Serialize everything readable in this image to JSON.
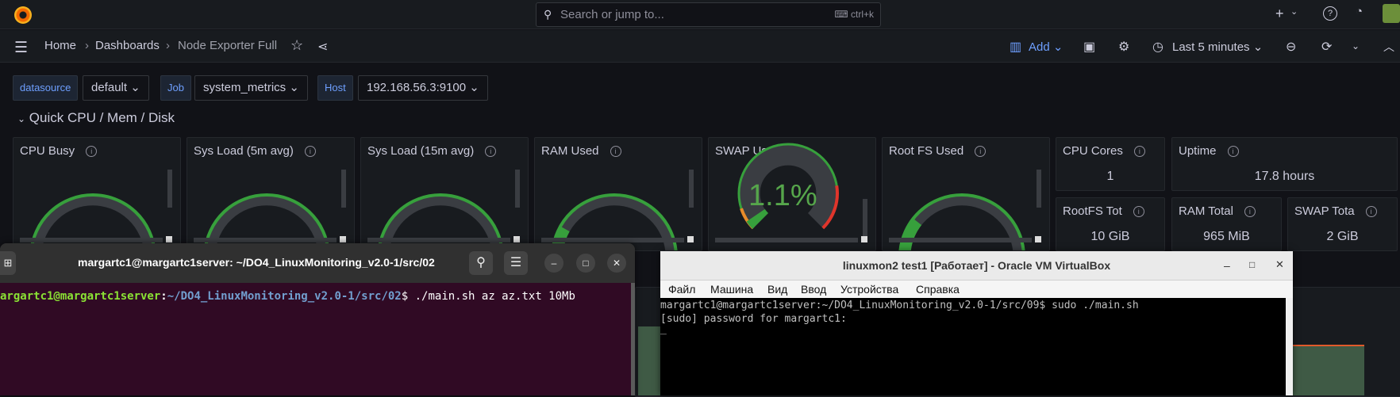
{
  "topbar": {
    "search_placeholder": "Search or jump to...",
    "shortcut": "ctrl+k"
  },
  "breadcrumb": {
    "home": "Home",
    "dashboards": "Dashboards",
    "current": "Node Exporter Full"
  },
  "toolbar": {
    "add_label": "Add",
    "time_range": "Last 5 minutes"
  },
  "variables": [
    {
      "label": "datasource",
      "value": "default"
    },
    {
      "label": "Job",
      "value": "system_metrics"
    },
    {
      "label": "Host",
      "value": "192.168.56.3:9100"
    }
  ],
  "row_title": "Quick CPU / Mem / Disk",
  "gauges": [
    {
      "title": "CPU Busy",
      "percent": 0
    },
    {
      "title": "Sys Load (5m avg)",
      "percent": 0
    },
    {
      "title": "Sys Load (15m avg)",
      "percent": 0
    },
    {
      "title": "RAM Used",
      "percent": 0.15
    },
    {
      "title": "SWAP Used",
      "value_text": "1.1%",
      "percent": 0.011
    },
    {
      "title": "Root FS Used",
      "percent": 0.2
    }
  ],
  "stats": [
    {
      "title": "CPU Cores",
      "value": "1"
    },
    {
      "title": "Uptime",
      "value": "17.8 hours"
    },
    {
      "title": "RootFS Tot",
      "value": "10 GiB"
    },
    {
      "title": "RAM Total",
      "value": "965 MiB"
    },
    {
      "title": "SWAP Tota",
      "value": "2 GiB"
    }
  ],
  "colors": {
    "gauge_green": "#37a03c",
    "gauge_bg": "#3a3d42",
    "swap_value": "#56a64b",
    "threshold_red": "#e0352b",
    "threshold_orange": "#e88b2a",
    "terminal_bg": "#300a24",
    "prompt_user": "#8ae234",
    "prompt_path": "#729fcf"
  },
  "terminal": {
    "title": "margartc1@margartc1server: ~/DO4_LinuxMonitoring_v2.0-1/src/02",
    "prompt_user": "argartc1@margartc1server",
    "prompt_sep": ":",
    "prompt_path": "~/DO4_LinuxMonitoring_v2.0-1/src/02",
    "prompt_end": "$ ./main.sh az az.txt 10Mb",
    "icons": [
      "new-tab-icon",
      "search-icon",
      "hamburger-icon",
      "minimize-icon",
      "maximize-icon",
      "close-icon"
    ]
  },
  "vbox": {
    "title": "linuxmon2 test1 [Работает] - Oracle VM VirtualBox",
    "menu": [
      "Файл",
      "Машина",
      "Вид",
      "Ввод",
      "Устройства",
      "Справка"
    ],
    "line1": "margartc1@margartc1server:~/DO4_LinuxMonitoring_v2.0-1/src/09$ sudo ./main.sh",
    "line2": "[sudo] password for margartc1:",
    "cursor": "_"
  }
}
